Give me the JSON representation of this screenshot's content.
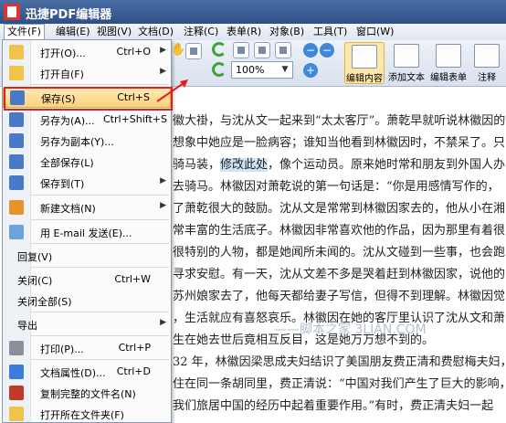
{
  "window": {
    "title": "迅捷PDF编辑器"
  },
  "menubar": [
    {
      "label": "文件(F)"
    },
    {
      "label": "编辑(E)"
    },
    {
      "label": "视图(V)"
    },
    {
      "label": "文档(D)"
    },
    {
      "label": "注释(C)"
    },
    {
      "label": "表单(R)"
    },
    {
      "label": "对象(B)"
    },
    {
      "label": "工具(T)"
    },
    {
      "label": "窗口(W)"
    }
  ],
  "toolbar": {
    "zoom_value": "100%",
    "buttons": [
      {
        "label": "编辑内容",
        "icon": "edit-content-icon"
      },
      {
        "label": "添加文本",
        "icon": "add-text-icon"
      },
      {
        "label": "编辑表单",
        "icon": "edit-form-icon"
      },
      {
        "label": "注释",
        "icon": "annotate-icon"
      }
    ]
  },
  "file_menu": {
    "items": [
      {
        "label": "打开(O)...",
        "shortcut": "Ctrl+O",
        "submenu": true,
        "icon": "open-folder-icon"
      },
      {
        "label": "打开自(F)",
        "shortcut": "",
        "submenu": true,
        "icon": "open-from-icon"
      },
      {
        "label": "保存(S)",
        "shortcut": "Ctrl+S",
        "submenu": false,
        "icon": "save-icon"
      },
      {
        "label": "另存为(A)...",
        "shortcut": "Ctrl+Shift+S",
        "submenu": false,
        "icon": "save-as-icon"
      },
      {
        "label": "另存为副本(Y)...",
        "shortcut": "",
        "submenu": false,
        "icon": "save-copy-icon"
      },
      {
        "label": "全部保存(L)",
        "shortcut": "",
        "submenu": false,
        "icon": "save-all-icon"
      },
      {
        "label": "保存到(T)",
        "shortcut": "",
        "submenu": true,
        "icon": "save-to-icon"
      },
      {
        "label": "新建文档(N)",
        "shortcut": "",
        "submenu": true,
        "icon": "new-document-icon"
      },
      {
        "label": "用 E-mail 发送(E)...",
        "shortcut": "",
        "submenu": false,
        "icon": "email-icon"
      },
      {
        "label": "回复(V)",
        "shortcut": "",
        "submenu": false,
        "icon": ""
      },
      {
        "label": "关闭(C)",
        "shortcut": "Ctrl+W",
        "submenu": false,
        "icon": ""
      },
      {
        "label": "关闭全部(S)",
        "shortcut": "",
        "submenu": false,
        "icon": ""
      },
      {
        "label": "导出",
        "shortcut": "",
        "submenu": true,
        "icon": ""
      },
      {
        "label": "打印(P)...",
        "shortcut": "Ctrl+P",
        "submenu": false,
        "icon": "print-icon"
      },
      {
        "label": "文档属性(D)...",
        "shortcut": "Ctrl+D",
        "submenu": false,
        "icon": "document-properties-icon"
      },
      {
        "label": "复制完整的文件名(N)",
        "shortcut": "",
        "submenu": false,
        "icon": "copy-filename-icon"
      },
      {
        "label": "打开所在文件夹(F)",
        "shortcut": "",
        "submenu": false,
        "icon": "open-containing-folder-icon"
      }
    ]
  },
  "document": {
    "lines": [
      "徽大褂，与沈从文一起来到“太太客厅”。萧乾早就听说林徽因的",
      "想象中她应是一脸病容；谁知当他看到林徽因时，不禁呆了。只",
      "骑马装，",
      "去骑马。林徽因对萧乾说的第一句话是：“你是用感情写作的，",
      "了萧乾很大的鼓励。沈从文是常常到林徽因家去的，他从小在湘",
      "常丰富的生活底子。林徽因非常喜欢他的作品，因为那里有着很",
      "很特别的人物，都是她闻所未闻的。沈从文碰到一些事，也会跑",
      "寻求安慰。有一天，沈从文差不多是哭着赶到林徽因家，说他的",
      "苏州娘家去了，他每天都给妻子写信，但得不到理解。林徽因觉",
      "，生活就应有喜怒哀乐。林徽因在她的客厅里认识了沈从文和萧",
      "生在她去世后竟相互反目，这是她万万想不到的。",
      "32 年，林徽因梁思成夫妇结识了美国朋友费正清和费慰梅夫妇，",
      "住在同一条胡同里，费正清说：“中国对我们产生了巨大的影响，",
      "我们旅居中国的经历中起着重要作用。”有时，费正清夫妇一起"
    ],
    "highlight": "修改此处",
    "line3_after": "，像个运动员。原来她时常和朋友到外国人办",
    "watermark": "——脚本之家 3LIAN.COM"
  }
}
